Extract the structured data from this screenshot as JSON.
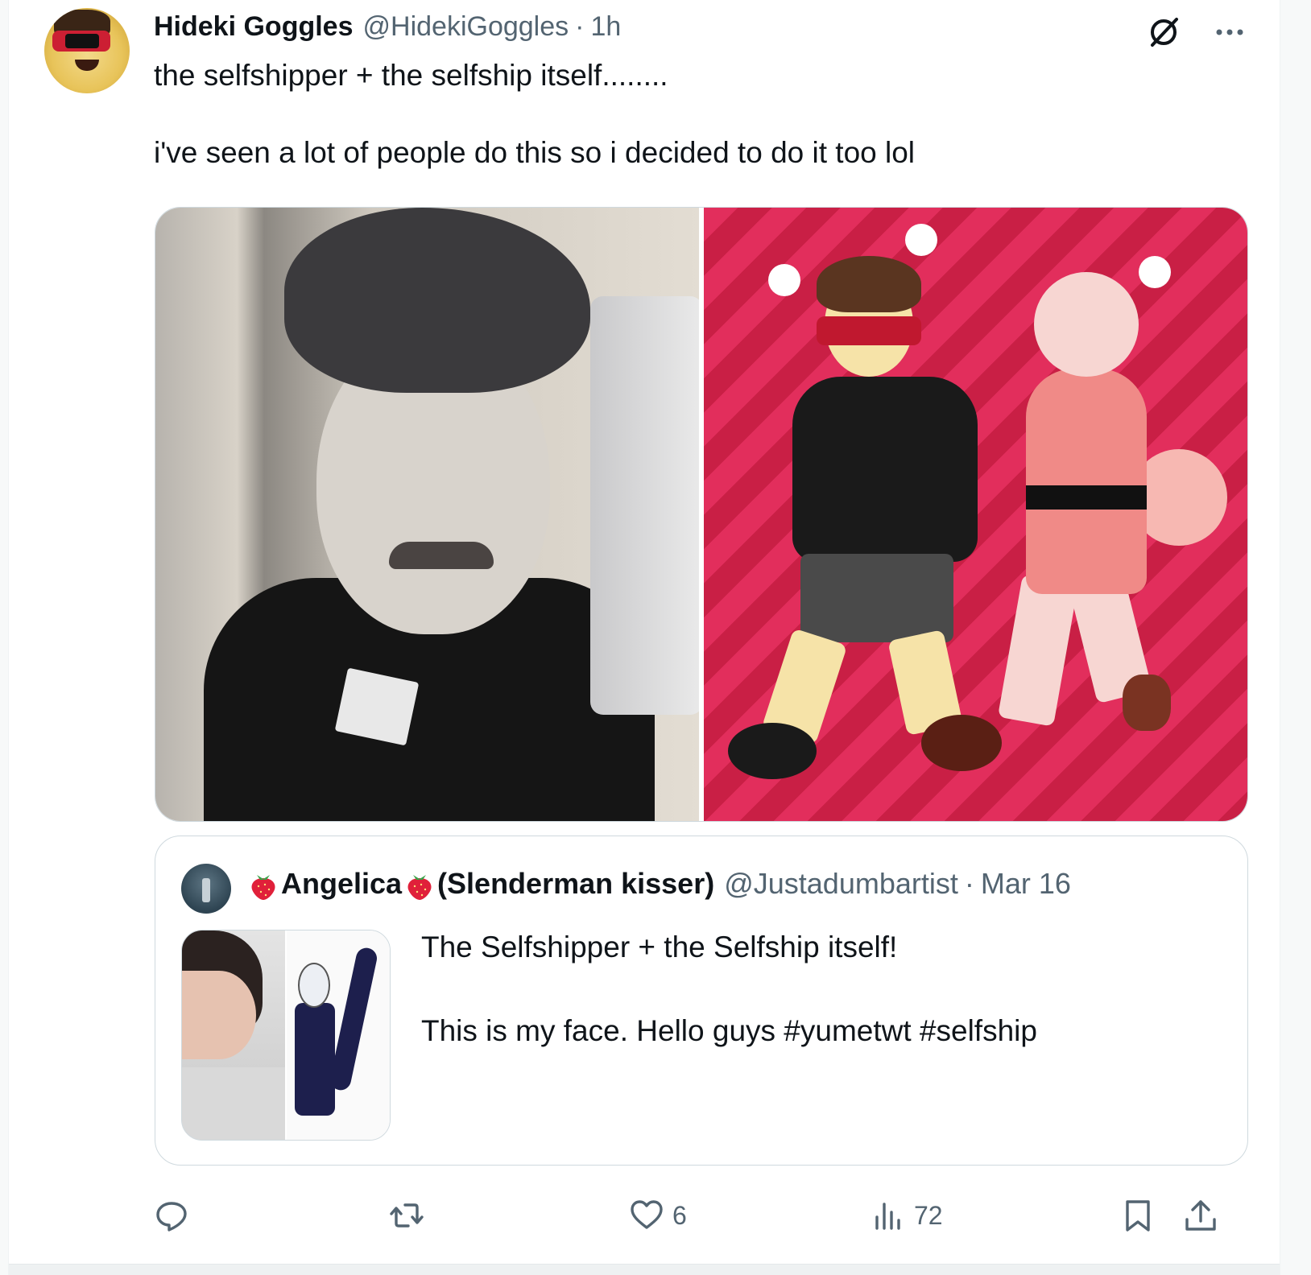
{
  "tweet": {
    "author": {
      "display_name": "Hideki Goggles",
      "handle": "@HidekiGoggles",
      "separator": "·",
      "time": "1h"
    },
    "text": "the selfshipper + the selfship itself........\n\ni've seen a lot of people do this so i decided to do it too lol",
    "media": {
      "left": "photo-of-person",
      "right": "drawn-artwork"
    }
  },
  "quoted": {
    "display_name_first": "Angelica",
    "display_name_rest": "(Slenderman kisser)",
    "handle": "@Justadumbartist",
    "separator": "·",
    "date": "Mar 16",
    "text": "The Selfshipper + the Selfship itself!\n\nThis is my face. Hello guys #yumetwt #selfship"
  },
  "actions": {
    "reply_count": "",
    "repost_count": "",
    "like_count": "6",
    "views_count": "72"
  },
  "icons": [
    "grok-icon",
    "more-icon",
    "reply-icon",
    "repost-icon",
    "like-icon",
    "views-icon",
    "bookmark-icon",
    "share-icon",
    "strawberry-icon"
  ],
  "colors": {
    "text_primary": "#0f1419",
    "text_secondary": "#536471",
    "border": "#cfd9de"
  }
}
